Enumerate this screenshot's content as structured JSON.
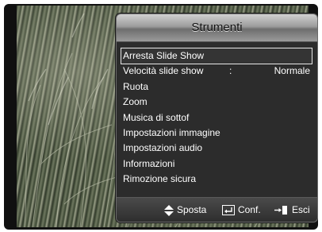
{
  "menu": {
    "title": "Strumenti",
    "items": [
      {
        "label": "Arresta Slide Show",
        "selected": true
      },
      {
        "label": "Velocità slide show",
        "separator": ":",
        "value": "Normale"
      },
      {
        "label": "Ruota"
      },
      {
        "label": "Zoom"
      },
      {
        "label": "Musica di sottof"
      },
      {
        "label": "Impostazioni immagine"
      },
      {
        "label": "Impostazioni audio"
      },
      {
        "label": "Informazioni"
      },
      {
        "label": "Rimozione sicura"
      }
    ]
  },
  "footer": {
    "move_label": "Sposta",
    "confirm_label": "Conf.",
    "exit_label": "Esci",
    "move_icon": "up-down-arrows-icon",
    "confirm_icon": "enter-icon",
    "exit_icon": "exit-icon"
  }
}
